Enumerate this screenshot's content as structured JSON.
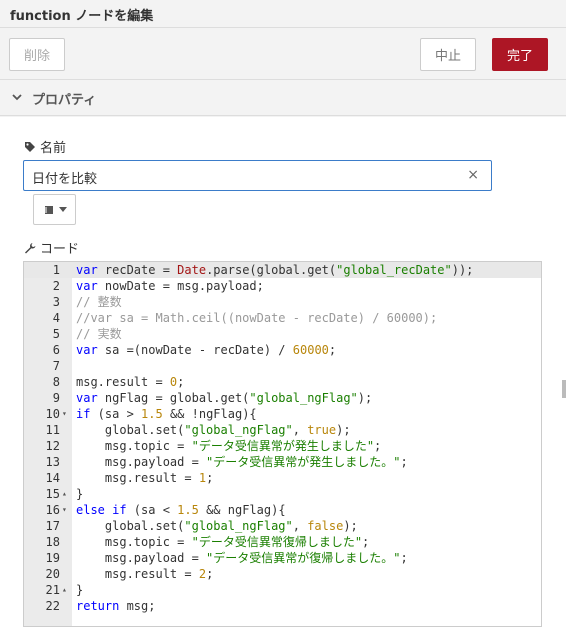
{
  "title": "function ノードを編集",
  "toolbar": {
    "delete_label": "削除",
    "cancel_label": "中止",
    "done_label": "完了"
  },
  "section": {
    "label": "プロパティ"
  },
  "name_field": {
    "label": "名前",
    "value": "日付を比較",
    "clear_glyph": "×"
  },
  "code_field": {
    "label": "コード"
  },
  "colors": {
    "done_button": "#ad1625",
    "input_border": "#3b7cc9",
    "keyword": "#0000ff",
    "string": "#1a7f00",
    "number": "#b8860b",
    "comment": "#999999"
  },
  "code_lines": [
    {
      "n": "1",
      "fold": "",
      "tokens": [
        [
          "kw",
          "var"
        ],
        [
          "id",
          " recDate = "
        ],
        [
          "cls",
          "Date"
        ],
        [
          "id",
          ".parse(global.get("
        ],
        [
          "str",
          "\"global_recDate\""
        ],
        [
          "id",
          "));"
        ]
      ]
    },
    {
      "n": "2",
      "fold": "",
      "tokens": [
        [
          "kw",
          "var"
        ],
        [
          "id",
          " nowDate = msg.payload;"
        ]
      ]
    },
    {
      "n": "3",
      "fold": "",
      "tokens": [
        [
          "cm",
          "// 整数"
        ]
      ]
    },
    {
      "n": "4",
      "fold": "",
      "tokens": [
        [
          "cm",
          "//var sa = Math.ceil((nowDate - recDate) / 60000);"
        ]
      ]
    },
    {
      "n": "5",
      "fold": "",
      "tokens": [
        [
          "cm",
          "// 実数"
        ]
      ]
    },
    {
      "n": "6",
      "fold": "",
      "tokens": [
        [
          "kw",
          "var"
        ],
        [
          "id",
          " sa =(nowDate - recDate) / "
        ],
        [
          "num",
          "60000"
        ],
        [
          "id",
          ";"
        ]
      ]
    },
    {
      "n": "7",
      "fold": "",
      "tokens": []
    },
    {
      "n": "8",
      "fold": "",
      "tokens": [
        [
          "id",
          "msg.result = "
        ],
        [
          "num",
          "0"
        ],
        [
          "id",
          ";"
        ]
      ]
    },
    {
      "n": "9",
      "fold": "",
      "tokens": [
        [
          "kw",
          "var"
        ],
        [
          "id",
          " ngFlag = global.get("
        ],
        [
          "str",
          "\"global_ngFlag\""
        ],
        [
          "id",
          ");"
        ]
      ]
    },
    {
      "n": "10",
      "fold": "▾",
      "tokens": [
        [
          "kw",
          "if"
        ],
        [
          "id",
          " (sa > "
        ],
        [
          "num",
          "1.5"
        ],
        [
          "id",
          " && !ngFlag){"
        ]
      ]
    },
    {
      "n": "11",
      "fold": "",
      "tokens": [
        [
          "id",
          "    global.set("
        ],
        [
          "str",
          "\"global_ngFlag\""
        ],
        [
          "id",
          ", "
        ],
        [
          "bool",
          "true"
        ],
        [
          "id",
          ");"
        ]
      ]
    },
    {
      "n": "12",
      "fold": "",
      "tokens": [
        [
          "id",
          "    msg.topic = "
        ],
        [
          "str",
          "\"データ受信異常が発生しました\""
        ],
        [
          "id",
          ";"
        ]
      ]
    },
    {
      "n": "13",
      "fold": "",
      "tokens": [
        [
          "id",
          "    msg.payload = "
        ],
        [
          "str",
          "\"データ受信異常が発生しました。\""
        ],
        [
          "id",
          ";"
        ]
      ]
    },
    {
      "n": "14",
      "fold": "",
      "tokens": [
        [
          "id",
          "    msg.result = "
        ],
        [
          "num",
          "1"
        ],
        [
          "id",
          ";"
        ]
      ]
    },
    {
      "n": "15",
      "fold": "▴",
      "tokens": [
        [
          "id",
          "}"
        ]
      ]
    },
    {
      "n": "16",
      "fold": "▾",
      "tokens": [
        [
          "kw",
          "else if"
        ],
        [
          "id",
          " (sa < "
        ],
        [
          "num",
          "1.5"
        ],
        [
          "id",
          " && ngFlag){"
        ]
      ]
    },
    {
      "n": "17",
      "fold": "",
      "tokens": [
        [
          "id",
          "    global.set("
        ],
        [
          "str",
          "\"global_ngFlag\""
        ],
        [
          "id",
          ", "
        ],
        [
          "bool",
          "false"
        ],
        [
          "id",
          ");"
        ]
      ]
    },
    {
      "n": "18",
      "fold": "",
      "tokens": [
        [
          "id",
          "    msg.topic = "
        ],
        [
          "str",
          "\"データ受信異常復帰しました\""
        ],
        [
          "id",
          ";"
        ]
      ]
    },
    {
      "n": "19",
      "fold": "",
      "tokens": [
        [
          "id",
          "    msg.payload = "
        ],
        [
          "str",
          "\"データ受信異常が復帰しました。\""
        ],
        [
          "id",
          ";"
        ]
      ]
    },
    {
      "n": "20",
      "fold": "",
      "tokens": [
        [
          "id",
          "    msg.result = "
        ],
        [
          "num",
          "2"
        ],
        [
          "id",
          ";"
        ]
      ]
    },
    {
      "n": "21",
      "fold": "▴",
      "tokens": [
        [
          "id",
          "}"
        ]
      ]
    },
    {
      "n": "22",
      "fold": "",
      "tokens": [
        [
          "kw",
          "return"
        ],
        [
          "id",
          " msg;"
        ]
      ]
    }
  ]
}
